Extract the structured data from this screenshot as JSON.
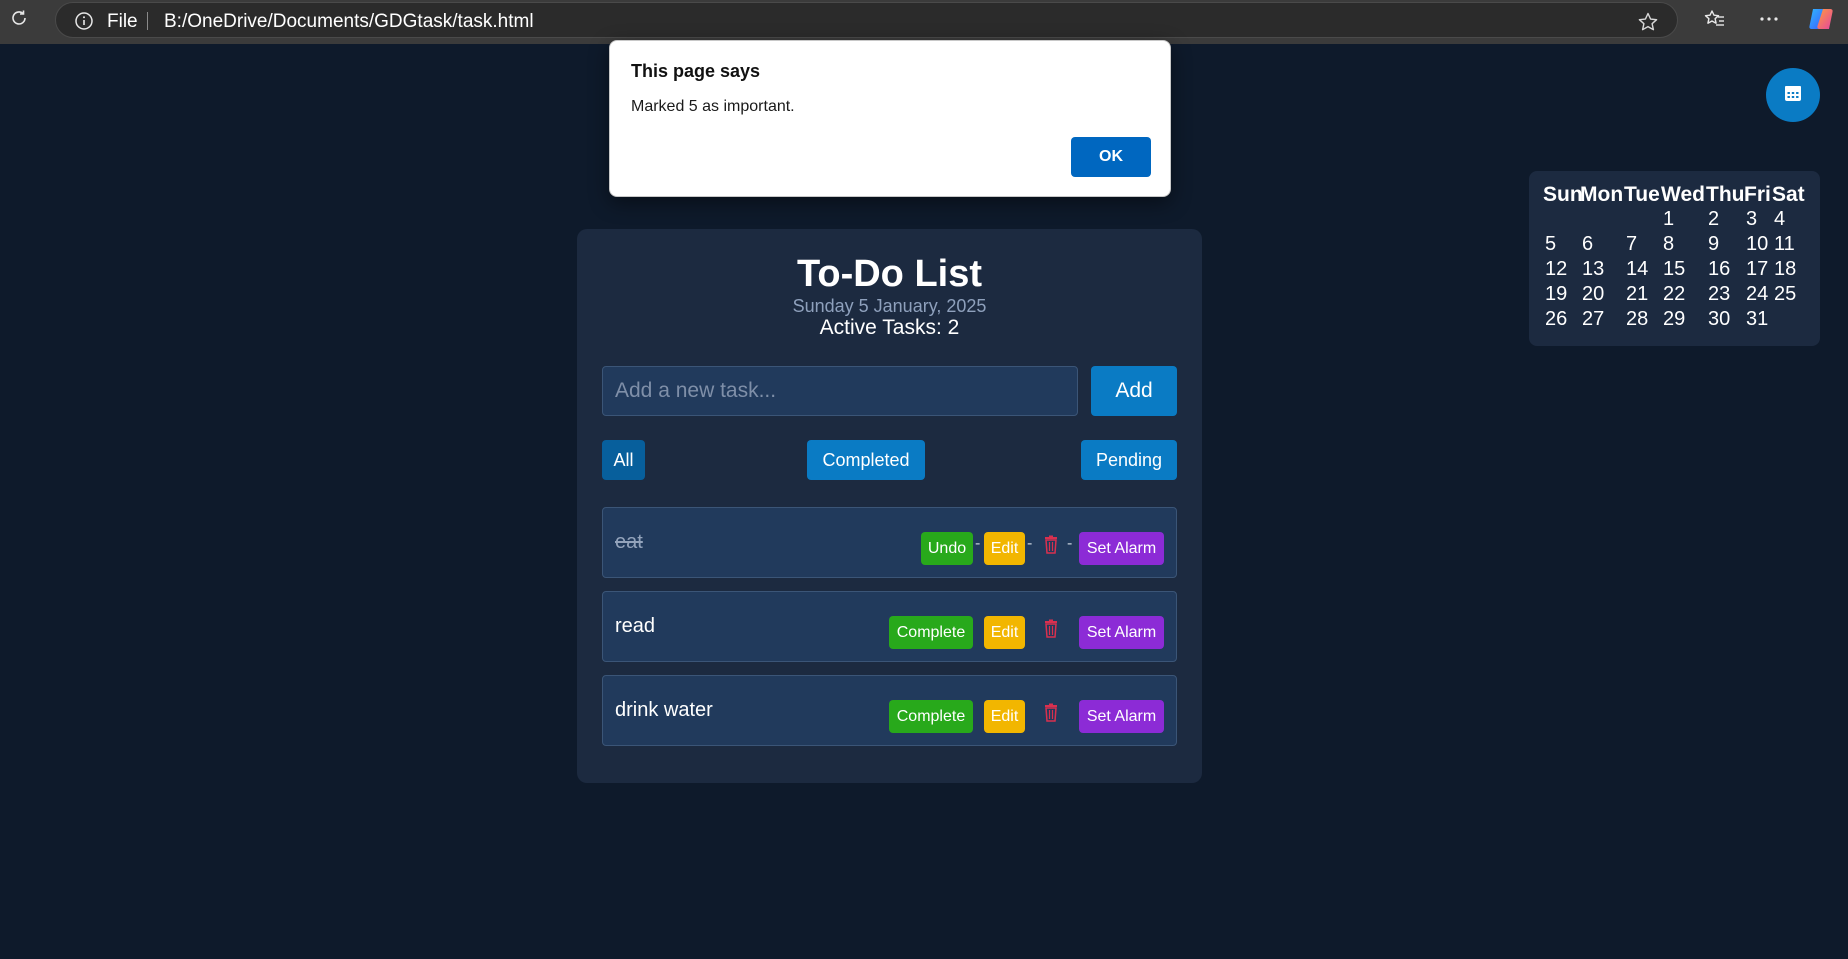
{
  "browser": {
    "file_label": "File",
    "url": "B:/OneDrive/Documents/GDGtask/task.html"
  },
  "dialog": {
    "title": "This page says",
    "message": "Marked 5 as important.",
    "ok_label": "OK"
  },
  "calendar": {
    "headers": [
      "Sun",
      "Mon",
      "Tue",
      "Wed",
      "Thu",
      "Fri",
      "Sat"
    ],
    "weeks": [
      [
        "",
        "",
        "",
        "1",
        "2",
        "3",
        "4"
      ],
      [
        "5",
        "6",
        "7",
        "8",
        "9",
        "10",
        "11"
      ],
      [
        "12",
        "13",
        "14",
        "15",
        "16",
        "17",
        "18"
      ],
      [
        "19",
        "20",
        "21",
        "22",
        "23",
        "24",
        "25"
      ],
      [
        "26",
        "27",
        "28",
        "29",
        "30",
        "31",
        ""
      ]
    ]
  },
  "app": {
    "title": "To-Do List",
    "date": "Sunday 5 January, 2025",
    "active_tasks": "Active Tasks: 2",
    "input_placeholder": "Add a new task...",
    "add_label": "Add",
    "filters": {
      "all": "All",
      "completed": "Completed",
      "pending": "Pending"
    },
    "tasks": [
      {
        "text": "eat",
        "toggle_label": "Undo",
        "edit_label": "Edit",
        "alarm_label": "Set Alarm",
        "dash": "-"
      },
      {
        "text": "read",
        "toggle_label": "Complete",
        "edit_label": "Edit",
        "alarm_label": "Set Alarm"
      },
      {
        "text": "drink water",
        "toggle_label": "Complete",
        "edit_label": "Edit",
        "alarm_label": "Set Alarm"
      }
    ]
  },
  "colors": {
    "background": "#0e1a2b",
    "card": "#1c2a40",
    "primary": "#0a7bc4",
    "complete": "#28a91b",
    "edit": "#f2b600",
    "alarm": "#8c2bd6",
    "trash": "#d9304f"
  },
  "icons": {
    "reload": "reload-icon",
    "info": "info-icon",
    "star": "star-icon",
    "favorites": "favorites-icon",
    "more": "more-icon",
    "copilot": "copilot-icon",
    "calendar": "calendar-icon",
    "trash": "trash-icon"
  }
}
